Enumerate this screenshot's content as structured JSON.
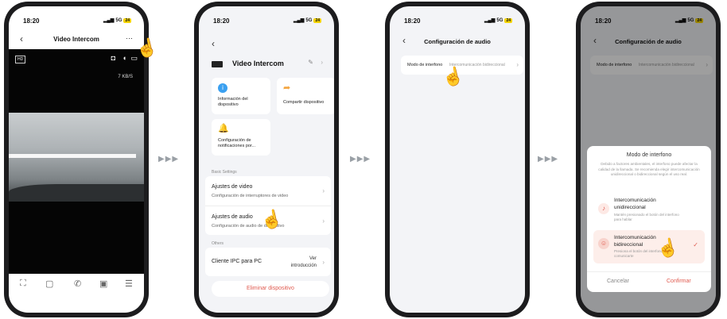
{
  "common": {
    "time": "18:20",
    "network": "5G",
    "battery": "24"
  },
  "screen1": {
    "title": "Video Intercom",
    "more": "···",
    "hd": "HD",
    "speed": "7 KB/S"
  },
  "screen2": {
    "device_name": "Video Intercom",
    "tiles": [
      "Información del dispositivo",
      "Compartir dispositivo",
      "Configuración de notificaciones por..."
    ],
    "section_basic": "Basic Settings",
    "video_title": "Ajustes de video",
    "video_sub": "Configuración de interruptores de video",
    "audio_title": "Ajustes de audio",
    "audio_sub": "Configuración de audio de dispositivo",
    "section_others": "Others",
    "pc_title": "Cliente IPC para PC",
    "pc_action": "Ver introducción",
    "remove": "Eliminar dispositivo"
  },
  "screen3": {
    "title": "Configuración de audio",
    "row_label": "Modo de interfono",
    "row_value": "Intercomunicación bidireccional"
  },
  "screen4": {
    "title": "Configuración de audio",
    "row_label": "Modo de interfono",
    "row_value": "Intercomunicación bidireccional",
    "dialog_title": "Modo de interfono",
    "dialog_desc": "Debido a factores ambientales, el interfono puede afectar la calidad de la llamada. Se recomienda elegir intercomunicación unidireccional o bidireccional según el uso real.",
    "opt1_title": "Intercomunicación unidireccional",
    "opt1_desc": "Mantén presionado el botón del interfono para hablar",
    "opt2_title": "Intercomunicación bidireccional",
    "opt2_desc": "Presiona el botón del interfono para comunicarte",
    "cancel": "Cancelar",
    "confirm": "Confirmar"
  },
  "colors": {
    "accent": "#e05a4f",
    "icon_blue": "#3aa0f0",
    "icon_orange": "#f4a540"
  }
}
